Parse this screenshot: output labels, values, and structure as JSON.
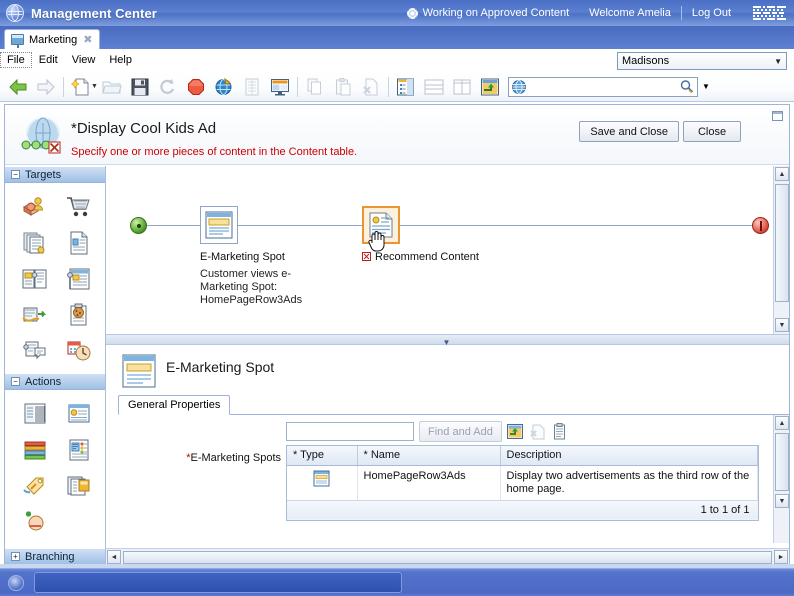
{
  "banner": {
    "logo_icon": "globe-icon",
    "title": "Management Center",
    "gear_icon": "gear-icon",
    "status": "Working on Approved Content",
    "welcome": "Welcome Amelia",
    "logout": "Log Out",
    "brand": "IBM"
  },
  "tab": {
    "icon": "presentation-icon",
    "label": "Marketing",
    "close_icon": "close-icon"
  },
  "menubar": {
    "items": [
      "File",
      "Edit",
      "View",
      "Help"
    ],
    "store_select": {
      "value": "Madisons",
      "caret_icon": "chevron-down-icon"
    }
  },
  "toolbar": {
    "buttons": [
      {
        "name": "back-icon",
        "tip": "Back"
      },
      {
        "name": "forward-icon",
        "tip": "Forward"
      },
      {
        "name": "new-icon",
        "tip": "New"
      },
      {
        "name": "open-icon",
        "tip": "Open"
      },
      {
        "name": "save-icon",
        "tip": "Save"
      },
      {
        "name": "refresh-icon",
        "tip": "Refresh"
      },
      {
        "name": "stop-icon",
        "tip": "Stop"
      },
      {
        "name": "preview-icon",
        "tip": "Preview"
      },
      {
        "name": "list-icon",
        "tip": "List"
      },
      {
        "name": "display-icon",
        "tip": "Display"
      },
      {
        "name": "copy-icon",
        "tip": "Copy"
      },
      {
        "name": "paste-icon",
        "tip": "Paste"
      },
      {
        "name": "delete-icon",
        "tip": "Delete"
      },
      {
        "name": "explorer-icon",
        "tip": "Explorer view"
      },
      {
        "name": "split-horizontal-icon",
        "tip": "Split horizontal"
      },
      {
        "name": "split-vertical-icon",
        "tip": "Split vertical"
      },
      {
        "name": "flow-icon",
        "tip": "Flow"
      }
    ],
    "search": {
      "icon": "search-globe-icon",
      "value": "",
      "placeholder": "",
      "go_icon": "search-icon",
      "caret_icon": "chevron-down-icon"
    }
  },
  "editor": {
    "icon": "activity-flow-icon",
    "title": "*Display Cool Kids Ad",
    "message": "Specify one or more pieces of content in the Content table.",
    "save_and_close": "Save and Close",
    "close": "Close",
    "restore_icon": "restore-icon"
  },
  "palette": {
    "sections": [
      {
        "name": "Targets",
        "expanded": true,
        "toggle": "−",
        "items": [
          "customer-segment-icon",
          "shopping-cart-icon",
          "catalog-pages-icon",
          "catalog-entry-icon",
          "search-criteria-icon",
          "category-page-icon",
          "registration-icon",
          "cookie-icon",
          "dialog-page-icon",
          "date-time-icon"
        ]
      },
      {
        "name": "Actions",
        "expanded": true,
        "toggle": "−",
        "items": [
          "display-catalog-icon",
          "recommend-content-icon",
          "display-list-icon",
          "display-category-icon",
          "issue-coupon-icon",
          "display-ads-icon",
          "add-to-cart-icon"
        ]
      },
      {
        "name": "Branching",
        "expanded": false,
        "toggle": "+",
        "items": []
      }
    ]
  },
  "canvas": {
    "start_node": "start-node",
    "end_node": "stop-node",
    "nodes": [
      {
        "id": "e-marketing-spot",
        "icon": "e-marketing-spot-icon",
        "label": "E-Marketing Spot",
        "sublabel": "Customer views e-Marketing Spot: HomePageRow3Ads",
        "selected": false,
        "error": false
      },
      {
        "id": "recommend-content",
        "icon": "recommend-content-icon",
        "label": "Recommend Content",
        "sublabel": "",
        "selected": true,
        "error": true
      }
    ],
    "cursor": "hand-cursor"
  },
  "detail": {
    "icon": "e-marketing-spot-icon",
    "title": "E-Marketing Spot",
    "tabs": [
      {
        "label": "General Properties",
        "active": true
      }
    ],
    "find": {
      "input_value": "",
      "input_placeholder": "",
      "button_label": "Find and Add",
      "icons": [
        "find-and-add-icon",
        "unlink-icon",
        "details-icon"
      ]
    },
    "field_label": "E-Marketing Spots",
    "field_required_marker": "*",
    "table": {
      "columns": [
        "* Type",
        "* Name",
        "Description"
      ],
      "rows": [
        {
          "type_icon": "e-marketing-spot-icon",
          "name": "HomePageRow3Ads",
          "description": "Display two advertisements as the third row of the home page."
        }
      ],
      "footer": "1 to 1 of 1"
    }
  },
  "scrollbars": {
    "up_arrow": "▲",
    "down_arrow": "▼",
    "left_arrow": "◄",
    "right_arrow": "►",
    "splitter_arrow": "▼"
  },
  "taskbar": {
    "start_icon": "start-orb-icon",
    "task_label": ""
  },
  "colors": {
    "banner_blue": "#4a6fc4",
    "accent_orange": "#e8962f",
    "error_red": "#cc0000",
    "panel_header": "#9fc0e6"
  }
}
